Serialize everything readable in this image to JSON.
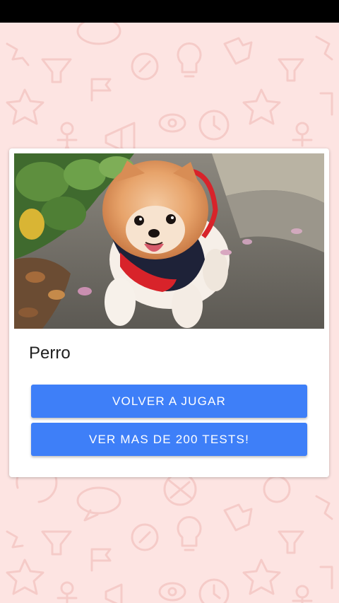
{
  "result": {
    "title": "Perro",
    "image_icon": "pomeranian-dog-photo"
  },
  "buttons": {
    "replay_label": "VOLVER A JUGAR",
    "more_tests_label": "VER MAS DE 200 TESTS!"
  },
  "colors": {
    "background": "#fde4e2",
    "pattern": "#f6c9c6",
    "button": "#3e7ff8",
    "status_bar": "#000000"
  }
}
